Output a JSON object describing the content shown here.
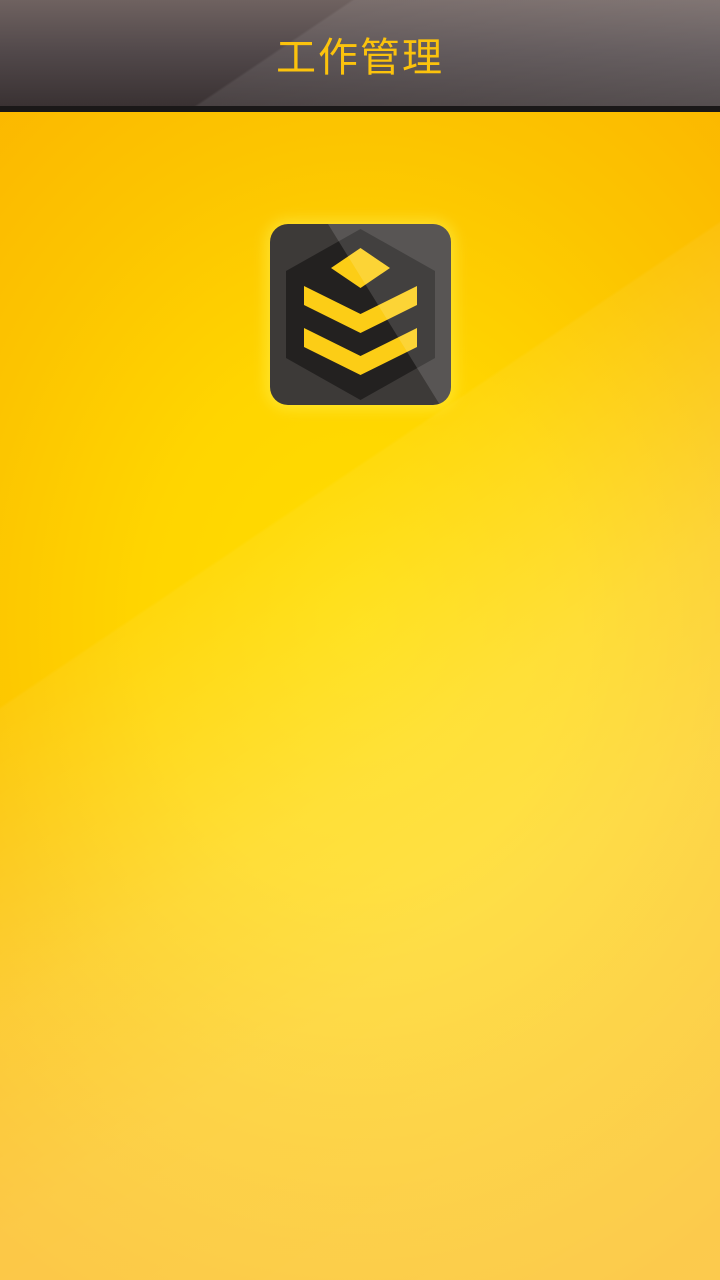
{
  "header": {
    "title": "工作管理"
  },
  "app_icon": {
    "icon": "stacked-layers-icon",
    "colors": {
      "tile": "#3d3a38",
      "hexagon": "#232120",
      "layers": "#fccd16"
    }
  },
  "colors": {
    "background_center": "#ffdd00",
    "background_edge": "#fbb300",
    "header_top": "#6f6260",
    "header_bottom": "#3a3233",
    "title_text": "#fcc30c"
  }
}
